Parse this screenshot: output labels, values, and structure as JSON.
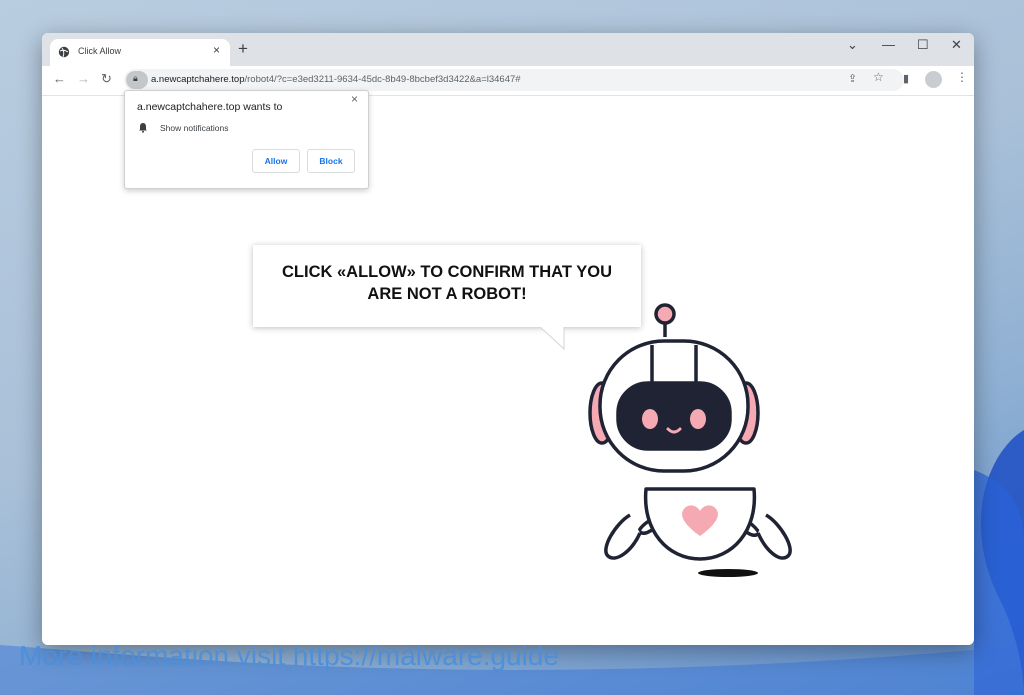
{
  "tab": {
    "title": "Click Allow",
    "close_label": "×",
    "new_tab_label": "+"
  },
  "window_controls": {
    "minimize": "—",
    "maximize": "☐",
    "close": "✕",
    "tab_list": "⌄"
  },
  "address_bar": {
    "domain": "a.newcaptchahere.top",
    "path": "/robot4/?c=e3ed3211-9634-45dc-8b49-8bcbef3d3422&a=l34647#"
  },
  "permission_prompt": {
    "title": "a.newcaptchahere.top wants to",
    "permission": "Show notifications",
    "allow_label": "Allow",
    "block_label": "Block",
    "close_label": "×"
  },
  "page": {
    "message_line1": "CLICK «ALLOW» TO CONFIRM THAT YOU",
    "message_line2": "ARE NOT A ROBOT!"
  },
  "watermark": "More information visit https://malware.guide",
  "icons": [
    "globe-icon",
    "back-icon",
    "forward-icon",
    "reload-icon",
    "lock-icon",
    "share-icon",
    "star-icon",
    "sidepanel-icon",
    "profile-icon",
    "menu-icon",
    "bell-icon"
  ],
  "colors": {
    "accent": "#1a73e8",
    "robot_pink": "#f5a9b3",
    "robot_outline": "#1f2333"
  }
}
